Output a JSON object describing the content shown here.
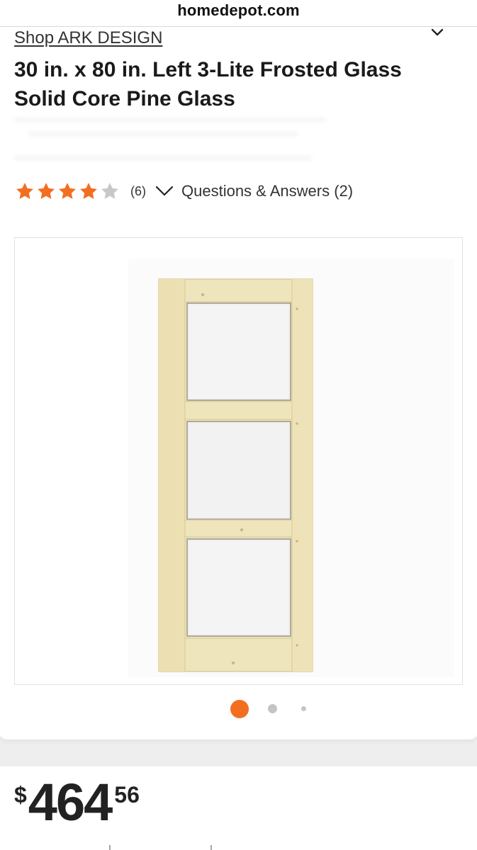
{
  "browser": {
    "url": "homedepot.com"
  },
  "product": {
    "brand_link": "Shop ARK DESIGN",
    "title": "30 in. x 80 in. Left 3-Lite Frosted Glass Solid Core Pine Glass",
    "rating": {
      "stars_filled": 4,
      "stars_total": 5,
      "review_count": "(6)"
    },
    "qa_link": "Questions & Answers (2)",
    "price": {
      "dollar_sign": "$",
      "whole": "464",
      "cents": "56"
    }
  },
  "gallery": {
    "image_name": "door-product-image",
    "dot_count": 3,
    "active_index": 0
  },
  "colors": {
    "accent_orange": "#f26f22",
    "star_gray": "#c8c8c8",
    "dot_gray": "#c4c4c4",
    "pine_wood": "#efe5bd",
    "frosted_glass": "#f0f0f0"
  },
  "icons": {
    "brand_chevron": "chevron-down-icon",
    "qa_chevron": "chevron-down-icon",
    "star": "star-icon"
  }
}
